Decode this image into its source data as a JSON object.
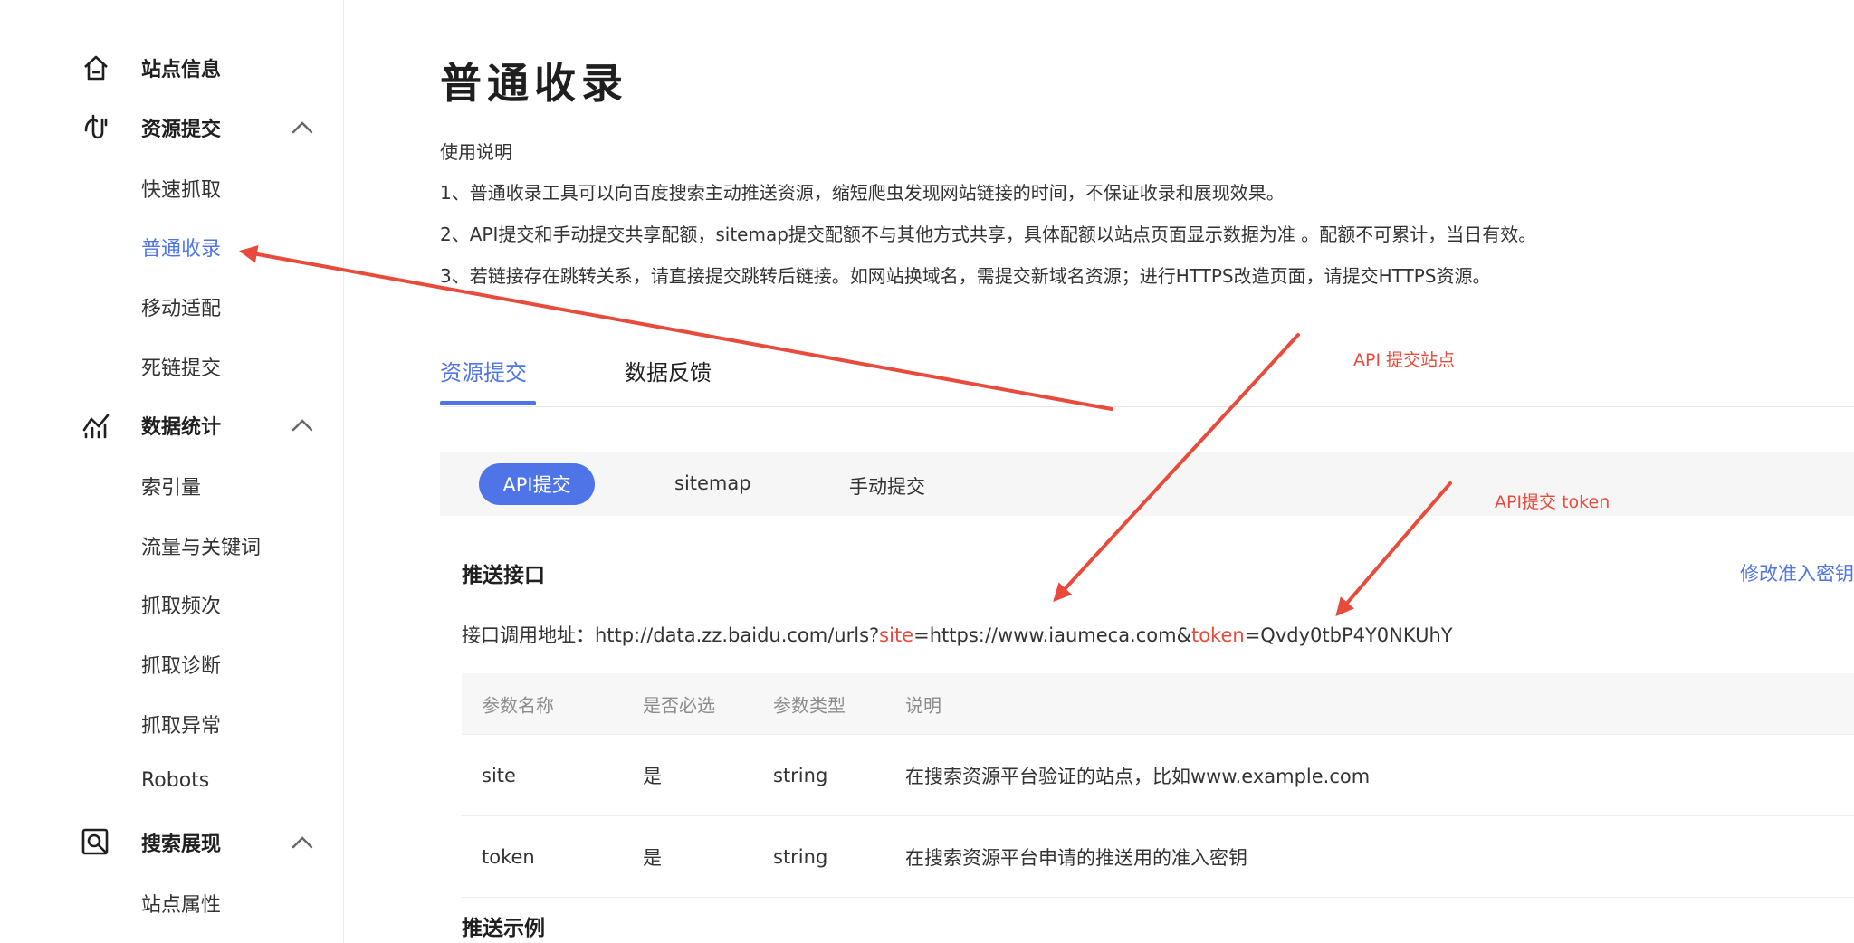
{
  "sidebar": {
    "groups": [
      {
        "label": "站点信息",
        "icon": "home-icon"
      },
      {
        "label": "资源提交",
        "icon": "submit-icon",
        "expanded": true
      },
      {
        "label": "数据统计",
        "icon": "stats-icon",
        "expanded": true
      },
      {
        "label": "搜索展现",
        "icon": "search-display-icon",
        "expanded": true
      }
    ],
    "items": [
      "快速抓取",
      "普通收录",
      "移动适配",
      "死链提交",
      "索引量",
      "流量与关键词",
      "抓取频次",
      "抓取诊断",
      "抓取异常",
      "Robots",
      "站点属性"
    ],
    "active_item": "普通收录"
  },
  "main": {
    "title": "普通收录",
    "instructions": [
      "使用说明",
      "1、普通收录工具可以向百度搜索主动推送资源，缩短爬虫发现网站链接的时间，不保证收录和展现效果。",
      "2、API提交和手动提交共享配额，sitemap提交配额不与其他方式共享，具体配额以站点页面显示数据为准 。配额不可累计，当日有效。",
      "3、若链接存在跳转关系，请直接提交跳转后链接。如网站换域名，需提交新域名资源；进行HTTPS改造页面，请提交HTTPS资源。"
    ],
    "tabs": [
      {
        "label": "资源提交",
        "active": true
      },
      {
        "label": "数据反馈"
      }
    ],
    "subtabs": [
      {
        "label": "API提交",
        "active": true
      },
      {
        "label": "sitemap"
      },
      {
        "label": "手动提交"
      }
    ],
    "push_title": "推送接口",
    "edit_link": "修改准入密钥",
    "endpoint": {
      "prefix": "接口调用地址：",
      "url_base": "http://data.zz.baidu.com/urls?",
      "site_key": "site",
      "site_value": "=https://www.iaumeca.com&",
      "token_key": "token",
      "token_value": "=Qvdy0tbP4Y0NKUhY"
    },
    "table": {
      "headers": [
        "参数名称",
        "是否必选",
        "参数类型",
        "说明"
      ],
      "rows": [
        [
          "site",
          "是",
          "string",
          "在搜索资源平台验证的站点，比如www.example.com"
        ],
        [
          "token",
          "是",
          "string",
          "在搜索资源平台申请的推送用的准入密钥"
        ]
      ]
    },
    "example_title": "推送示例"
  },
  "annotations": {
    "site_label": "API 提交站点",
    "token_label": "API提交 token",
    "color": "#e84a3c"
  },
  "colors": {
    "accent": "#4e74e8",
    "annotation": "#e84a3c"
  }
}
